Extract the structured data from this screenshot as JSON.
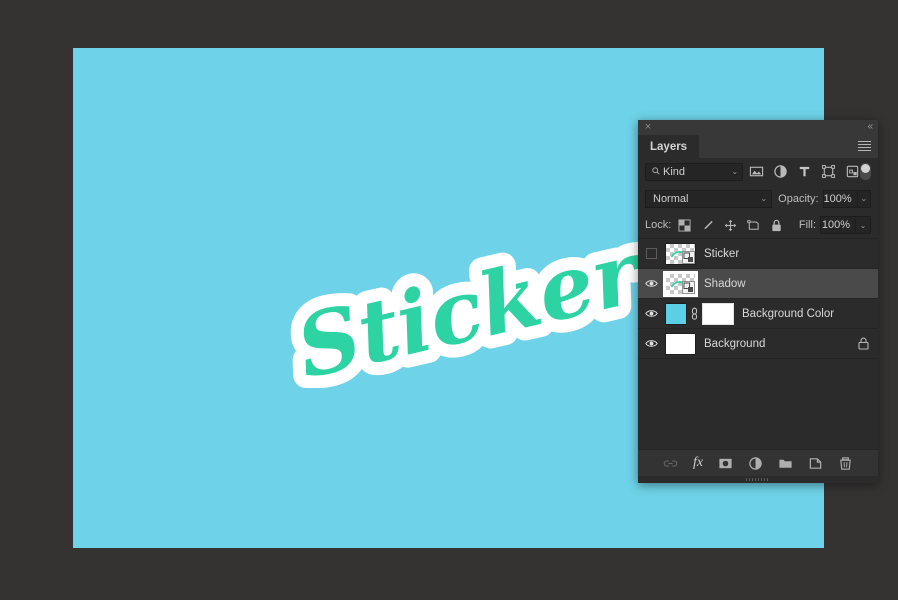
{
  "app": {
    "background_color": "#353332"
  },
  "canvas": {
    "name": "document-canvas",
    "background_color": "#6ed3e8",
    "artwork": {
      "text": "Sticker",
      "fill_color": "#2ed3a3",
      "outline_color": "#ffffff"
    }
  },
  "panel": {
    "close_icon": "×",
    "collapse_icon": "«",
    "menu_icon": "hamburger-menu",
    "tabs": [
      {
        "label": "Layers",
        "active": true
      }
    ],
    "filter_row": {
      "kind_label": "Kind",
      "search_icon": "magnifier-icon",
      "caret": "⌄",
      "filter_icons": [
        "pixel-layer-filter-icon",
        "adjustment-layer-filter-icon",
        "type-layer-filter-icon",
        "shape-layer-filter-icon",
        "smart-object-filter-icon"
      ],
      "toggle_label": "filter-enable-toggle"
    },
    "blend_row": {
      "blend_mode": "Normal",
      "opacity_label": "Opacity:",
      "opacity_value": "100%",
      "caret": "⌄"
    },
    "lock_row": {
      "lock_label": "Lock:",
      "lock_icons": [
        "lock-transparent-pixels-icon",
        "lock-image-pixels-icon",
        "lock-position-icon",
        "lock-artboard-nesting-icon",
        "lock-all-icon"
      ],
      "fill_label": "Fill:",
      "fill_value": "100%"
    },
    "layers": [
      {
        "name": "Sticker",
        "visible": false,
        "selected": false,
        "thumb_type": "checker",
        "smart_object": true,
        "locked": false,
        "has_mask": false,
        "linked": false
      },
      {
        "name": "Shadow",
        "visible": true,
        "selected": true,
        "thumb_type": "checker",
        "smart_object": true,
        "locked": false,
        "has_mask": false,
        "linked": false
      },
      {
        "name": "Background Color",
        "visible": true,
        "selected": false,
        "thumb_type": "solid",
        "thumb_color": "#5bcfe6",
        "smart_object": false,
        "locked": false,
        "has_mask": true,
        "linked": true
      },
      {
        "name": "Background",
        "visible": true,
        "selected": false,
        "thumb_type": "white",
        "smart_object": false,
        "locked": true,
        "has_mask": false,
        "linked": false
      }
    ],
    "bottom_toolbar": [
      "link-layers-icon",
      "layer-styles-fx-icon",
      "add-layer-mask-icon",
      "new-adjustment-layer-icon",
      "new-group-icon",
      "new-layer-icon",
      "delete-layer-icon"
    ],
    "bottom_toolbar_fx_label": "fx",
    "resize_grip": "panel-resize-grip"
  }
}
